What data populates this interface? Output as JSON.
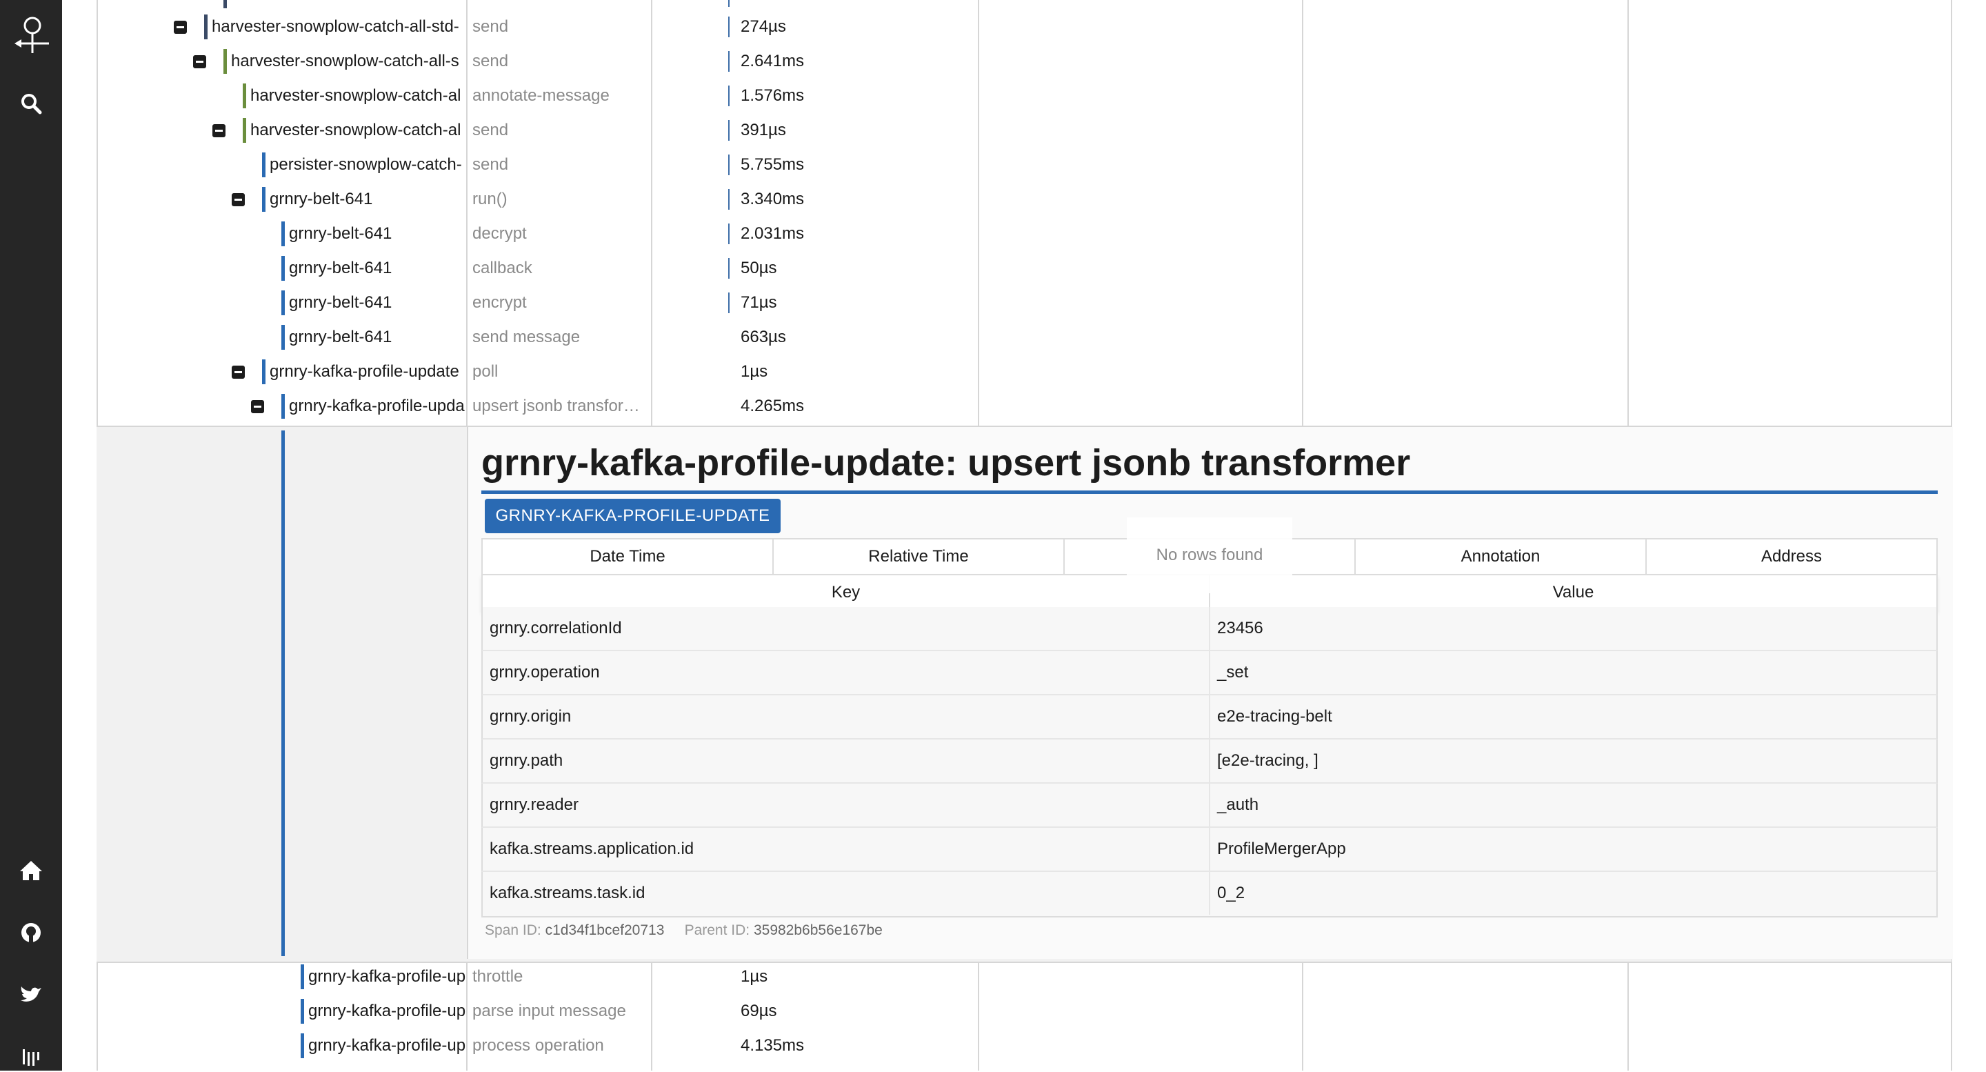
{
  "sidebar": {
    "logo_icon": "jaeger-logo-icon",
    "search_icon": "search-icon",
    "home_icon": "home-icon",
    "github_icon": "github-icon",
    "twitter_icon": "twitter-icon",
    "gitter_icon": "gitter-icon"
  },
  "colors": {
    "bar_blue": "#2a6ab3",
    "bar_green": "#6b8e3d",
    "bar_slate": "#3a4a66",
    "sidebar_bg": "#262626"
  },
  "rows_top": [
    {
      "service": "harvester-snowplow-catch-all-std-",
      "operation": "send",
      "duration": "274µs"
    },
    {
      "service": "harvester-snowplow-catch-all-s",
      "operation": "send",
      "duration": "2.641ms"
    },
    {
      "service": "harvester-snowplow-catch-al",
      "operation": "annotate-message",
      "duration": "1.576ms"
    },
    {
      "service": "harvester-snowplow-catch-al",
      "operation": "send",
      "duration": "391µs"
    },
    {
      "service": "persister-snowplow-catch-",
      "operation": "send",
      "duration": "5.755ms"
    },
    {
      "service": "grnry-belt-641",
      "operation": "run()",
      "duration": "3.340ms"
    },
    {
      "service": "grnry-belt-641",
      "operation": "decrypt",
      "duration": "2.031ms"
    },
    {
      "service": "grnry-belt-641",
      "operation": "callback",
      "duration": "50µs"
    },
    {
      "service": "grnry-belt-641",
      "operation": "encrypt",
      "duration": "71µs"
    },
    {
      "service": "grnry-belt-641",
      "operation": "send message",
      "duration": "663µs"
    },
    {
      "service": "grnry-kafka-profile-update",
      "operation": "poll",
      "duration": "1µs"
    },
    {
      "service": "grnry-kafka-profile-upda",
      "operation": "upsert jsonb transfor…",
      "duration": "4.265ms"
    }
  ],
  "detail": {
    "title": "grnry-kafka-profile-update: upsert jsonb transformer",
    "service_badge": "GRNRY-KAFKA-PROFILE-UPDATE",
    "logs_headers": [
      "Date Time",
      "Relative Time",
      "",
      "Annotation",
      "Address"
    ],
    "no_rows": "No rows found",
    "tags_headers": [
      "Key",
      "Value"
    ],
    "tags": [
      {
        "key": "grnry.correlationId",
        "value": "23456"
      },
      {
        "key": "grnry.operation",
        "value": "_set"
      },
      {
        "key": "grnry.origin",
        "value": "e2e-tracing-belt"
      },
      {
        "key": "grnry.path",
        "value": "[e2e-tracing, ]"
      },
      {
        "key": "grnry.reader",
        "value": "_auth"
      },
      {
        "key": "kafka.streams.application.id",
        "value": "ProfileMergerApp"
      },
      {
        "key": "kafka.streams.task.id",
        "value": "0_2"
      }
    ],
    "span_id_label": "Span ID:",
    "span_id": "c1d34f1bcef20713",
    "parent_id_label": "Parent ID:",
    "parent_id": "35982b6b56e167be"
  },
  "rows_bottom": [
    {
      "service": "grnry-kafka-profile-up",
      "operation": "throttle",
      "duration": "1µs"
    },
    {
      "service": "grnry-kafka-profile-up",
      "operation": "parse input message",
      "duration": "69µs"
    },
    {
      "service": "grnry-kafka-profile-up",
      "operation": "process operation",
      "duration": "4.135ms"
    }
  ]
}
